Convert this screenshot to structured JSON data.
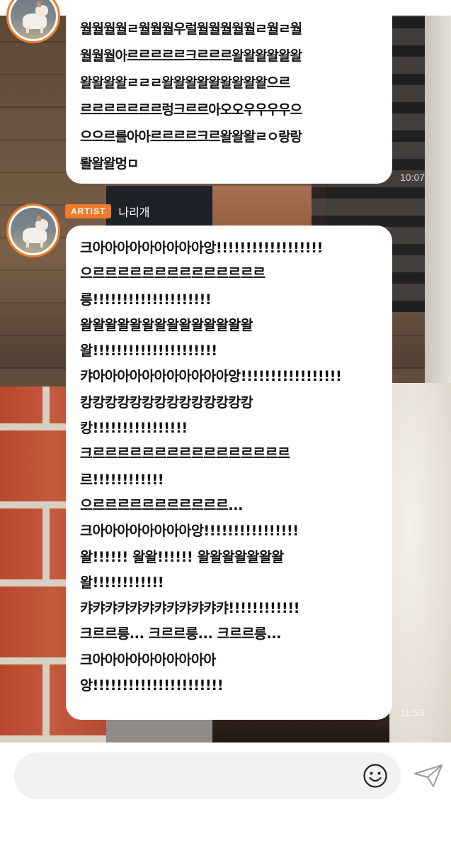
{
  "header": {
    "title_fragment": "bubble"
  },
  "messages": [
    {
      "lines": [
        "월월월월ㄹ월월월우럴월월월월월ㄹ월ㄹ월",
        "월월월아르르르르르크르르르왈왈왈왈왈왈",
        "왈왈왈왈ㄹㄹㄹ왈왈왈왈왈왈왈왈왈으르",
        "르르르르르르르렁크르르아오오우우우우으",
        "으으르를아아르르르르크르왈왈왈ㄹㅇ랑랑",
        "뢀왈왈멍ㅁ"
      ],
      "time": "10:07"
    },
    {
      "artist_badge": "ARTIST",
      "sender": "나리개",
      "lines": [
        "크아아아아아아아아아앙!!!!!!!!!!!!!!!!!!",
        "으르르르르르르르르르르르르르르",
        "릉!!!!!!!!!!!!!!!!!!!!",
        "왈왈왈왈왈왈왈왈왈왈왈왈왈왈",
        "왈!!!!!!!!!!!!!!!!!!!!!",
        "캬아아아아아아아아아아아앙!!!!!!!!!!!!!!!!!",
        "캉캉캉캉캉캉캉캉캉캉캉캉캉캉",
        "캉!!!!!!!!!!!!!!!!",
        "크르르르르르르르르르르르르르르르르",
        "르!!!!!!!!!!!!",
        "으르르르르르르르르르르르...",
        "크아아아아아아아아앙!!!!!!!!!!!!!!!!",
        "왈!!!!!! 왈왈!!!!!! 왈왈왈왈왈왈왈",
        "왈!!!!!!!!!!!!",
        "캬캬캬캬캬캬캬캬캬캬캬캬!!!!!!!!!!!!",
        "크르르릉... 크르르릉... 크르르릉...",
        "크아아아아아아아아아아",
        "앙!!!!!!!!!!!!!!!!!!!!!!"
      ],
      "time": "11:53"
    }
  ],
  "input": {
    "value": "",
    "placeholder": ""
  },
  "icons": {
    "emoji": "smiley-face-icon",
    "send": "paper-plane-send-icon"
  },
  "colors": {
    "accent": "#f07b2b",
    "bubble": "#ffffff",
    "input_bg": "#f2f2f4"
  }
}
